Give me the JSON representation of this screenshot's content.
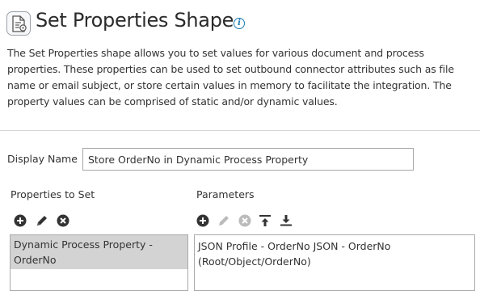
{
  "header": {
    "title": "Set Properties Shape",
    "icon": "document-properties-icon",
    "info_icon": "info-icon",
    "info_glyph": "i"
  },
  "description": "The Set Properties shape allows you to set values for various document and process properties. These properties can be used to set outbound connector attributes such as file name or email subject, or store certain values in memory to facilitate the integration. The property values can be comprised of static and/or dynamic values.",
  "form": {
    "display_name_label": "Display Name",
    "display_name_value": "Store OrderNo in Dynamic Process Property"
  },
  "properties_panel": {
    "label": "Properties to Set",
    "toolbar": [
      "add-icon",
      "edit-icon",
      "delete-icon"
    ],
    "items": [
      {
        "label": "Dynamic Process Property - OrderNo",
        "selected": true
      }
    ]
  },
  "parameters_panel": {
    "label": "Parameters",
    "toolbar": [
      "add-icon",
      "edit-icon-disabled",
      "delete-icon-disabled",
      "move-to-top-icon",
      "move-to-bottom-icon"
    ],
    "items": [
      {
        "label": "JSON Profile - OrderNo JSON - OrderNo (Root/Object/OrderNo)",
        "selected": false
      }
    ]
  },
  "colors": {
    "icon_dark": "#333333",
    "icon_disabled": "#bbbbbb",
    "info_blue": "#1a7ab3",
    "selected_row": "#d3d3d3",
    "border": "#a9a9a9"
  }
}
